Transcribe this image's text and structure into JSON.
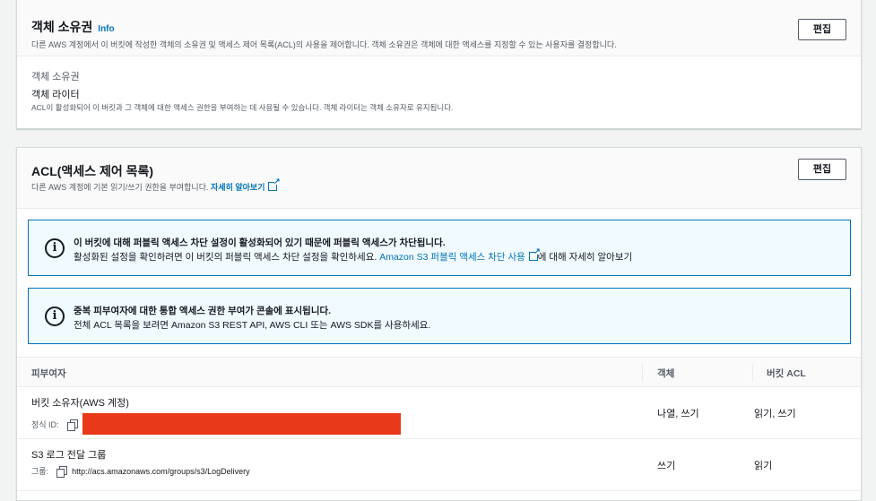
{
  "ownership": {
    "title": "객체 소유권",
    "info": "Info",
    "description": "다른 AWS 계정에서 이 버킷에 작성한 객체의 소유권 및 액세스 제어 목록(ACL)의 사용을 제어합니다. 객체 소유권은 객체에 대한 액세스를 지정할 수 있는 사용자를 결정합니다.",
    "edit_label": "편집",
    "field_label": "객체 소유권",
    "field_value": "객체 라이터",
    "field_hint": "ACL이 활성화되어 이 버킷과 그 객체에 대한 액세스 권한을 부여하는 데 사용될 수 있습니다. 객체 라이터는 객체 소유자로 유지됩니다."
  },
  "acl": {
    "title": "ACL(액세스 제어 목록)",
    "description": "다른 AWS 계정에 기본 읽기/쓰기 권한을 부여합니다.",
    "learn_more": "자세히 알아보기",
    "edit_label": "편집",
    "alerts": [
      {
        "title": "이 버킷에 대해 퍼블릭 액세스 차단 설정이 활성화되어 있기 때문에 퍼블릭 액세스가 차단됩니다.",
        "body_prefix": "활성화된 설정을 확인하려면 이 버킷의 퍼블릭 액세스 차단 설정을 확인하세요.",
        "link": "Amazon S3 퍼블릭 액세스 차단 사용",
        "body_suffix": "에 대해 자세히 알아보기"
      },
      {
        "title": "중복 피부여자에 대한 통합 액세스 권한 부여가 콘솔에 표시됩니다.",
        "body": "전체 ACL 목록을 보려면 Amazon S3 REST API, AWS CLI 또는 AWS SDK를 사용하세요."
      }
    ],
    "table": {
      "headers": [
        "피부여자",
        "객체",
        "버킷 ACL"
      ],
      "rows": [
        {
          "grantee": "버킷 소유자(AWS 계정)",
          "sub_label": "정식 ID:",
          "sub_value": "",
          "objects": "나열, 쓰기",
          "bucket_acl": "읽기, 쓰기"
        },
        {
          "grantee": "S3 로그 전달 그룹",
          "sub_label": "그룹:",
          "sub_value": "http://acs.amazonaws.com/groups/s3/LogDelivery",
          "objects": "쓰기",
          "bucket_acl": "읽기"
        }
      ]
    }
  },
  "colors": {
    "link": "#0073bb",
    "redaction": "#e8391a",
    "alert_bg": "#f1faff"
  }
}
